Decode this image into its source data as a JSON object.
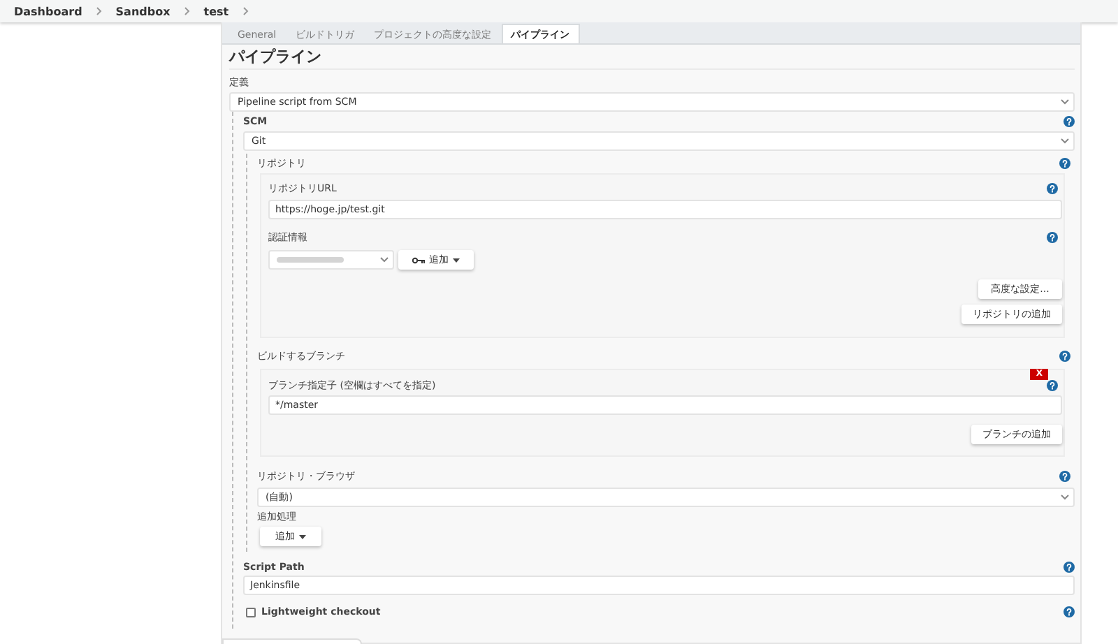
{
  "breadcrumbs": [
    "Dashboard",
    "Sandbox",
    "test"
  ],
  "tabs": [
    {
      "label": "General",
      "selected": false
    },
    {
      "label": "ビルドトリガ",
      "selected": false
    },
    {
      "label": "プロジェクトの高度な設定",
      "selected": false
    },
    {
      "label": "パイプライン",
      "selected": true
    }
  ],
  "section_title": "パイプライン",
  "definition": {
    "label": "定義",
    "value": "Pipeline script from SCM"
  },
  "scm": {
    "label": "SCM",
    "value": "Git"
  },
  "repositories": {
    "label": "リポジトリ",
    "url_label": "リポジトリURL",
    "url_value": "https://hoge.jp/test.git",
    "credentials_label": "認証情報",
    "add_button": "追加",
    "advanced_button": "高度な設定...",
    "add_repo_button": "リポジトリの追加"
  },
  "branches": {
    "label": "ビルドするブランチ",
    "delete_badge": "X",
    "specifier_label": "ブランチ指定子 (空欄はすべてを指定)",
    "value": "*/master",
    "add_button": "ブランチの追加"
  },
  "browser": {
    "label": "リポジトリ・ブラウザ",
    "value": "(自動)"
  },
  "additional": {
    "label": "追加処理",
    "button": "追加"
  },
  "script_path": {
    "label": "Script Path",
    "value": "Jenkinsfile"
  },
  "lightweight": {
    "label": "Lightweight checkout",
    "checked": false
  }
}
